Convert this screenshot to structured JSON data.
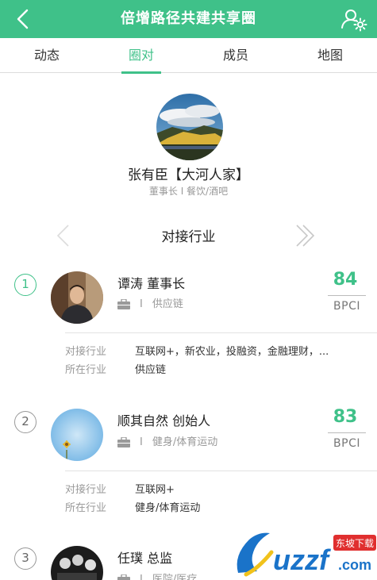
{
  "navbar": {
    "title": "倍增路径共建共享圈",
    "back_icon": "chevron-left-icon",
    "settings_icon": "user-settings-icon",
    "bg_color": "#3fc189"
  },
  "tabs": [
    {
      "label": "动态",
      "active": false
    },
    {
      "label": "圈对",
      "active": true
    },
    {
      "label": "成员",
      "active": false
    },
    {
      "label": "地图",
      "active": false
    }
  ],
  "profile": {
    "name": "张有臣【大河人家】",
    "subtitle": "董事长 I 餐饮/酒吧"
  },
  "section": {
    "title": "对接行业"
  },
  "matches": [
    {
      "rank": "1",
      "name": "谭涛 董事长",
      "sep": "I",
      "industry": "供应链",
      "score": "84",
      "score_label": "BPCI",
      "connect_label": "对接行业",
      "connect_value": "互联网+，新农业，投融资，金融理财，...",
      "current_label": "所在行业",
      "current_value": "供应链"
    },
    {
      "rank": "2",
      "name": "顺其自然 创始人",
      "sep": "I",
      "industry": "健身/体育运动",
      "score": "83",
      "score_label": "BPCI",
      "connect_label": "对接行业",
      "connect_value": "互联网+",
      "current_label": "所在行业",
      "current_value": "健身/体育运动"
    },
    {
      "rank": "3",
      "name": "任璞 总监",
      "sep": "I",
      "industry": "医院/医疗"
    }
  ],
  "watermark": {
    "brand": "uzzf",
    "suffix": ".com",
    "tag": "东坡下载"
  },
  "accent_color": "#3fc189"
}
